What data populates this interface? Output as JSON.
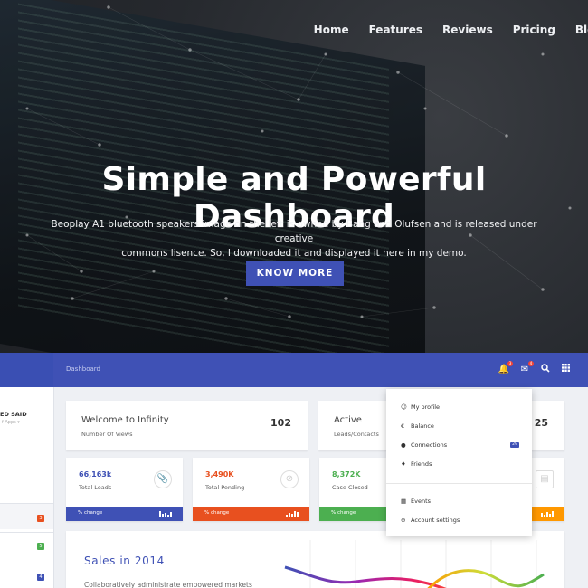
{
  "nav": {
    "items": [
      {
        "label": "Home"
      },
      {
        "label": "Features"
      },
      {
        "label": "Reviews"
      },
      {
        "label": "Pricing"
      },
      {
        "label": "Blog"
      }
    ]
  },
  "hero": {
    "title": "Simple and Powerful Dashboard",
    "subtitle_line1": "Beoplay A1 bluetooth speakers image on the left is owned by Bang and Olufsen and is released under creative",
    "subtitle_line2": "commons lisence. So, I downloaded it and displayed it here in my demo.",
    "cta_label": "KNOW MORE"
  },
  "dashboard": {
    "breadcrumb": "Dashboard",
    "sidebar_user": "ED SAID",
    "sidebar_user_sub": "f Apps ▾",
    "sidebar_badges": [
      {
        "count": "3",
        "color": "#e8501f"
      },
      {
        "count": "5",
        "color": "#4caf50"
      },
      {
        "count": "4",
        "color": "#3f51b5"
      }
    ],
    "top_icons": [
      {
        "icon": "bell-icon",
        "badge": "3"
      },
      {
        "icon": "mail-icon",
        "badge": "4"
      },
      {
        "icon": "search-icon"
      },
      {
        "icon": "apps-grid-icon"
      }
    ],
    "welcome_card": {
      "title": "Welcome to Infinity",
      "sub": "Number Of Views",
      "value": "102"
    },
    "active_card": {
      "title": "Active",
      "sub": "Leads/Contacts",
      "value": "25"
    },
    "stats": [
      {
        "value": "66,163k",
        "label": "Total Leads",
        "change": "% change",
        "color": "#3f51b5",
        "value_color": "#3f51b5",
        "icon": "paperclip-icon"
      },
      {
        "value": "3,490K",
        "label": "Total Pending",
        "change": "% change",
        "color": "#e8501f",
        "value_color": "#e8501f",
        "icon": "ban-icon"
      },
      {
        "value": "8,372K",
        "label": "Case Closed",
        "change": "% change",
        "color": "#4caf50",
        "value_color": "#4caf50",
        "icon": "check-icon"
      },
      {
        "value": "",
        "label": "",
        "change": "",
        "color": "#ff9800",
        "value_color": "#ff9800",
        "icon": "clipboard-icon"
      }
    ],
    "sales": {
      "title": "Sales in 2014",
      "subtitle": "Collaboratively administrate empowered markets"
    },
    "dropdown": {
      "items": [
        {
          "icon": "user-icon",
          "glyph": "☺",
          "label": "My profile"
        },
        {
          "icon": "euro-icon",
          "glyph": "€",
          "label": "Balance"
        },
        {
          "icon": "globe-icon",
          "glyph": "●",
          "label": "Connections",
          "badge": "29"
        },
        {
          "icon": "friends-icon",
          "glyph": "♦",
          "label": "Friends"
        },
        {
          "icon": "calendar-icon",
          "glyph": "▦",
          "label": "Events"
        },
        {
          "icon": "settings-icon",
          "glyph": "⊕",
          "label": "Account settings"
        }
      ]
    }
  }
}
